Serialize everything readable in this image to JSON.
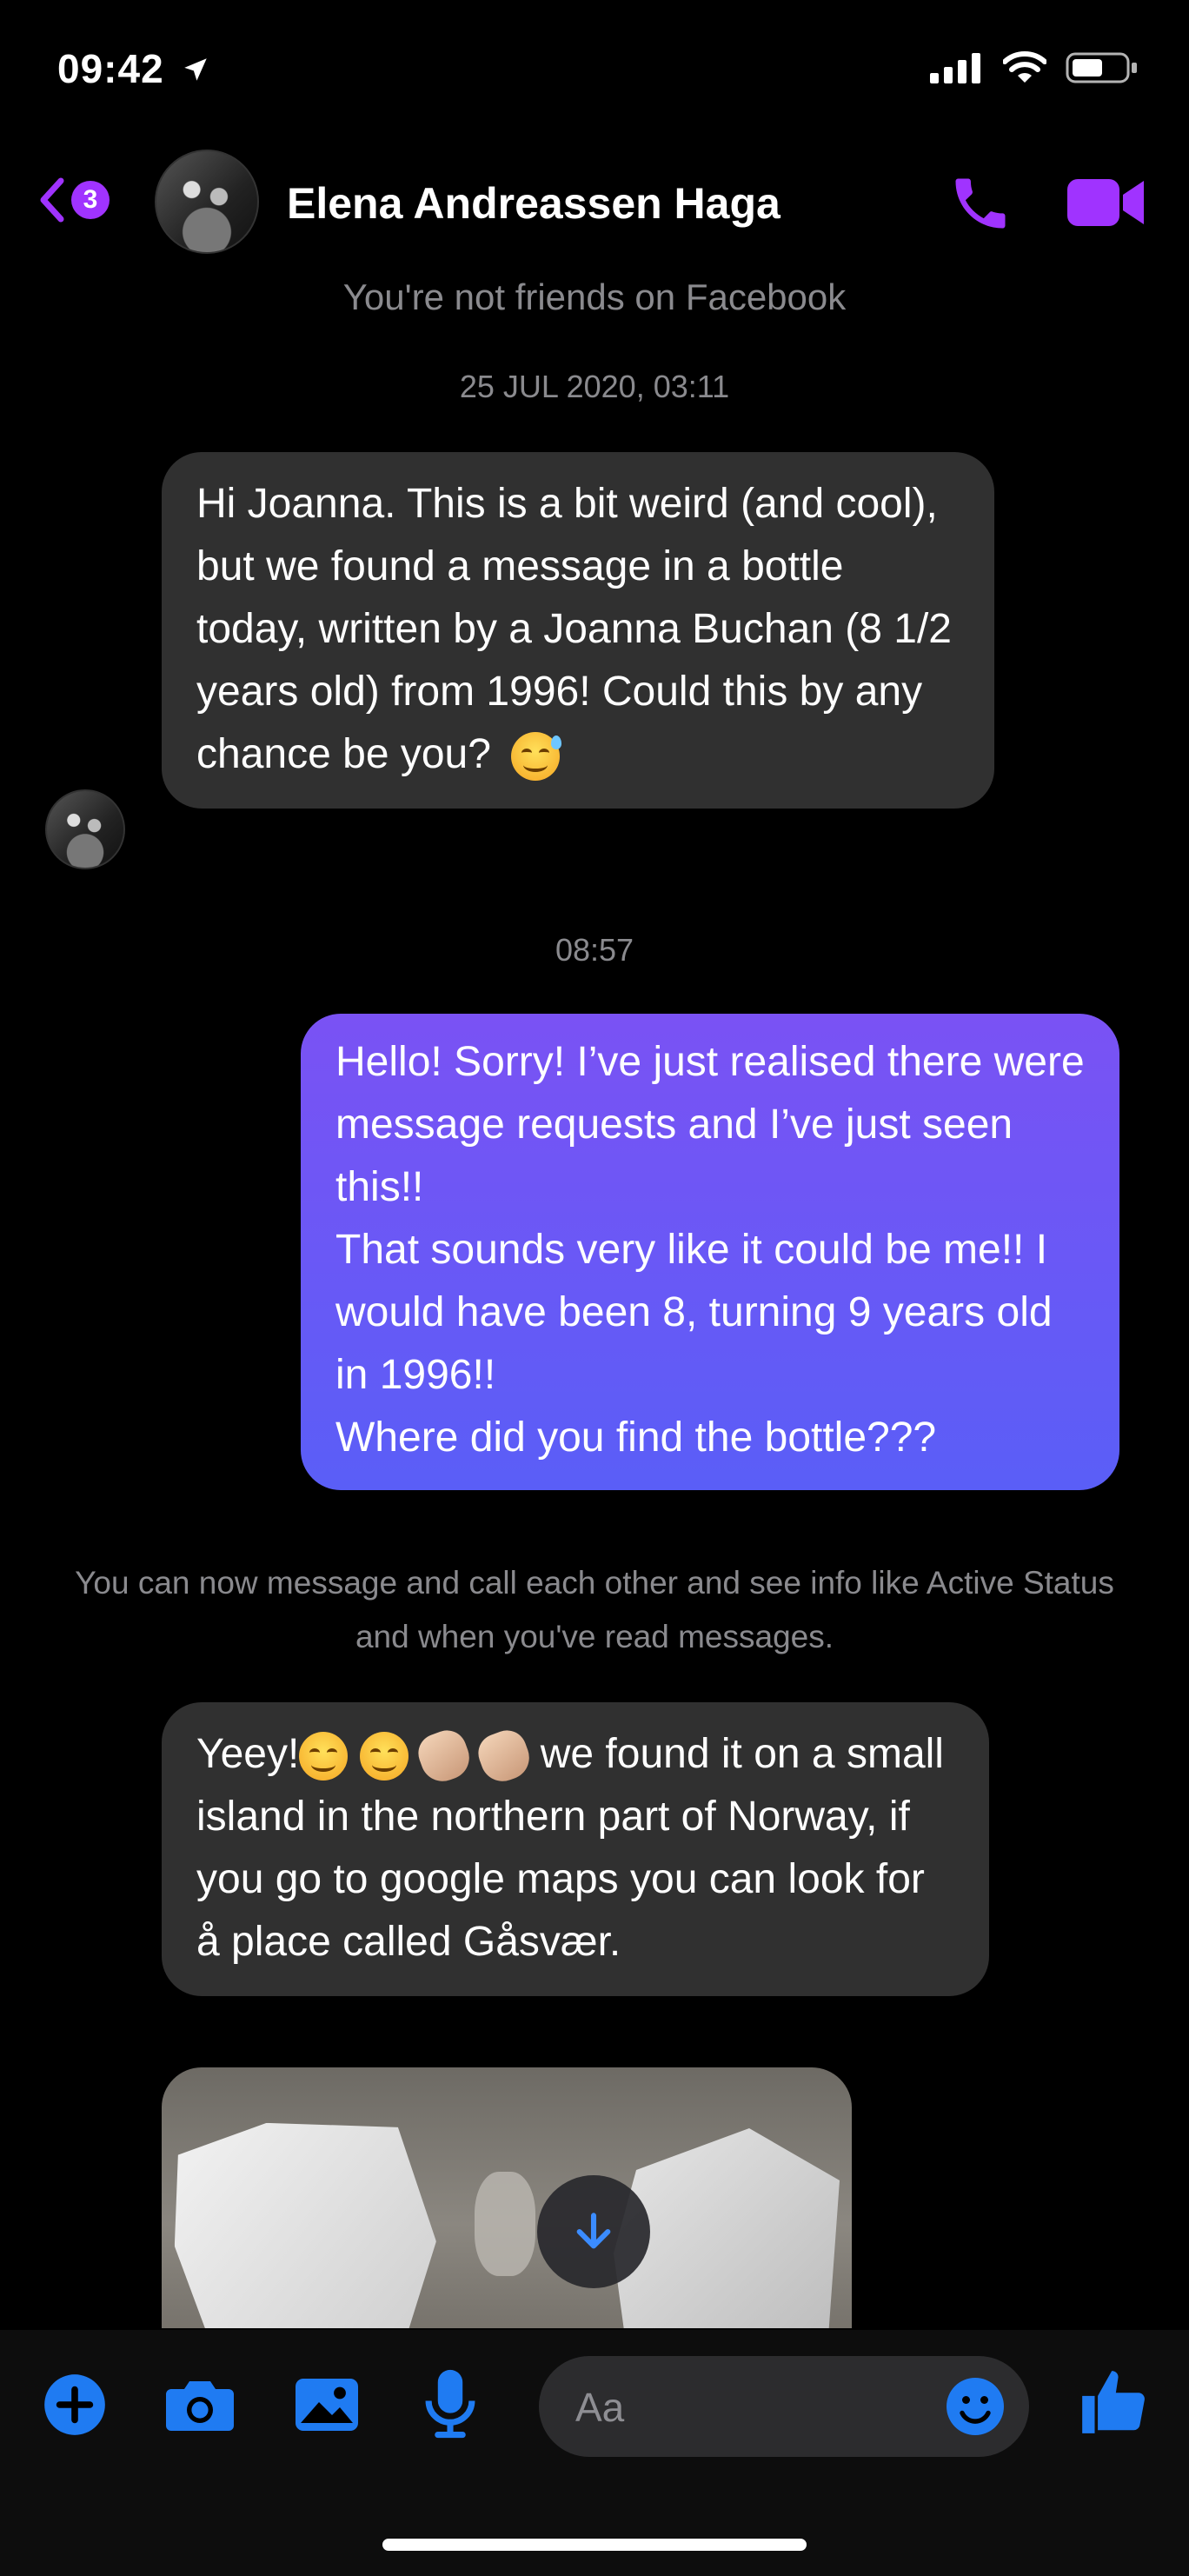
{
  "status_bar": {
    "time": "09:42"
  },
  "header": {
    "back_badge": "3",
    "contact_name": "Elena Andreassen Haga"
  },
  "thread": {
    "not_friends_note": "You're not friends on Facebook",
    "timestamp_1": "25 JUL 2020, 03:11",
    "msg_1": "Hi Joanna. This is a bit weird (and cool), but we found a message in a bottle today, written by a Joanna Buchan (8 1/2 years old) from 1996! Could this by any chance be you?",
    "timestamp_2": "08:57",
    "msg_2": "Hello!  Sorry! I’ve just realised there were message requests and I’ve just seen this!!\nThat sounds very like it could be me!! I would have been 8, turning 9 years old in 1996!!\nWhere did you find the bottle???",
    "system_note": "You can now message and call each other and see info like Active Status and when you've read messages.",
    "msg_3_prefix": "Yeey!",
    "msg_3_text": " we found it on a small island in the northern part of Norway, if you go to google maps you can look for å place called Gåsvær."
  },
  "composer": {
    "placeholder": "Aa"
  },
  "colors": {
    "accent": "#a033ff",
    "outgoing_bubble": "#6a58f5",
    "incoming_bubble": "#303030",
    "toolbar_icons": "#1f7bf2"
  }
}
